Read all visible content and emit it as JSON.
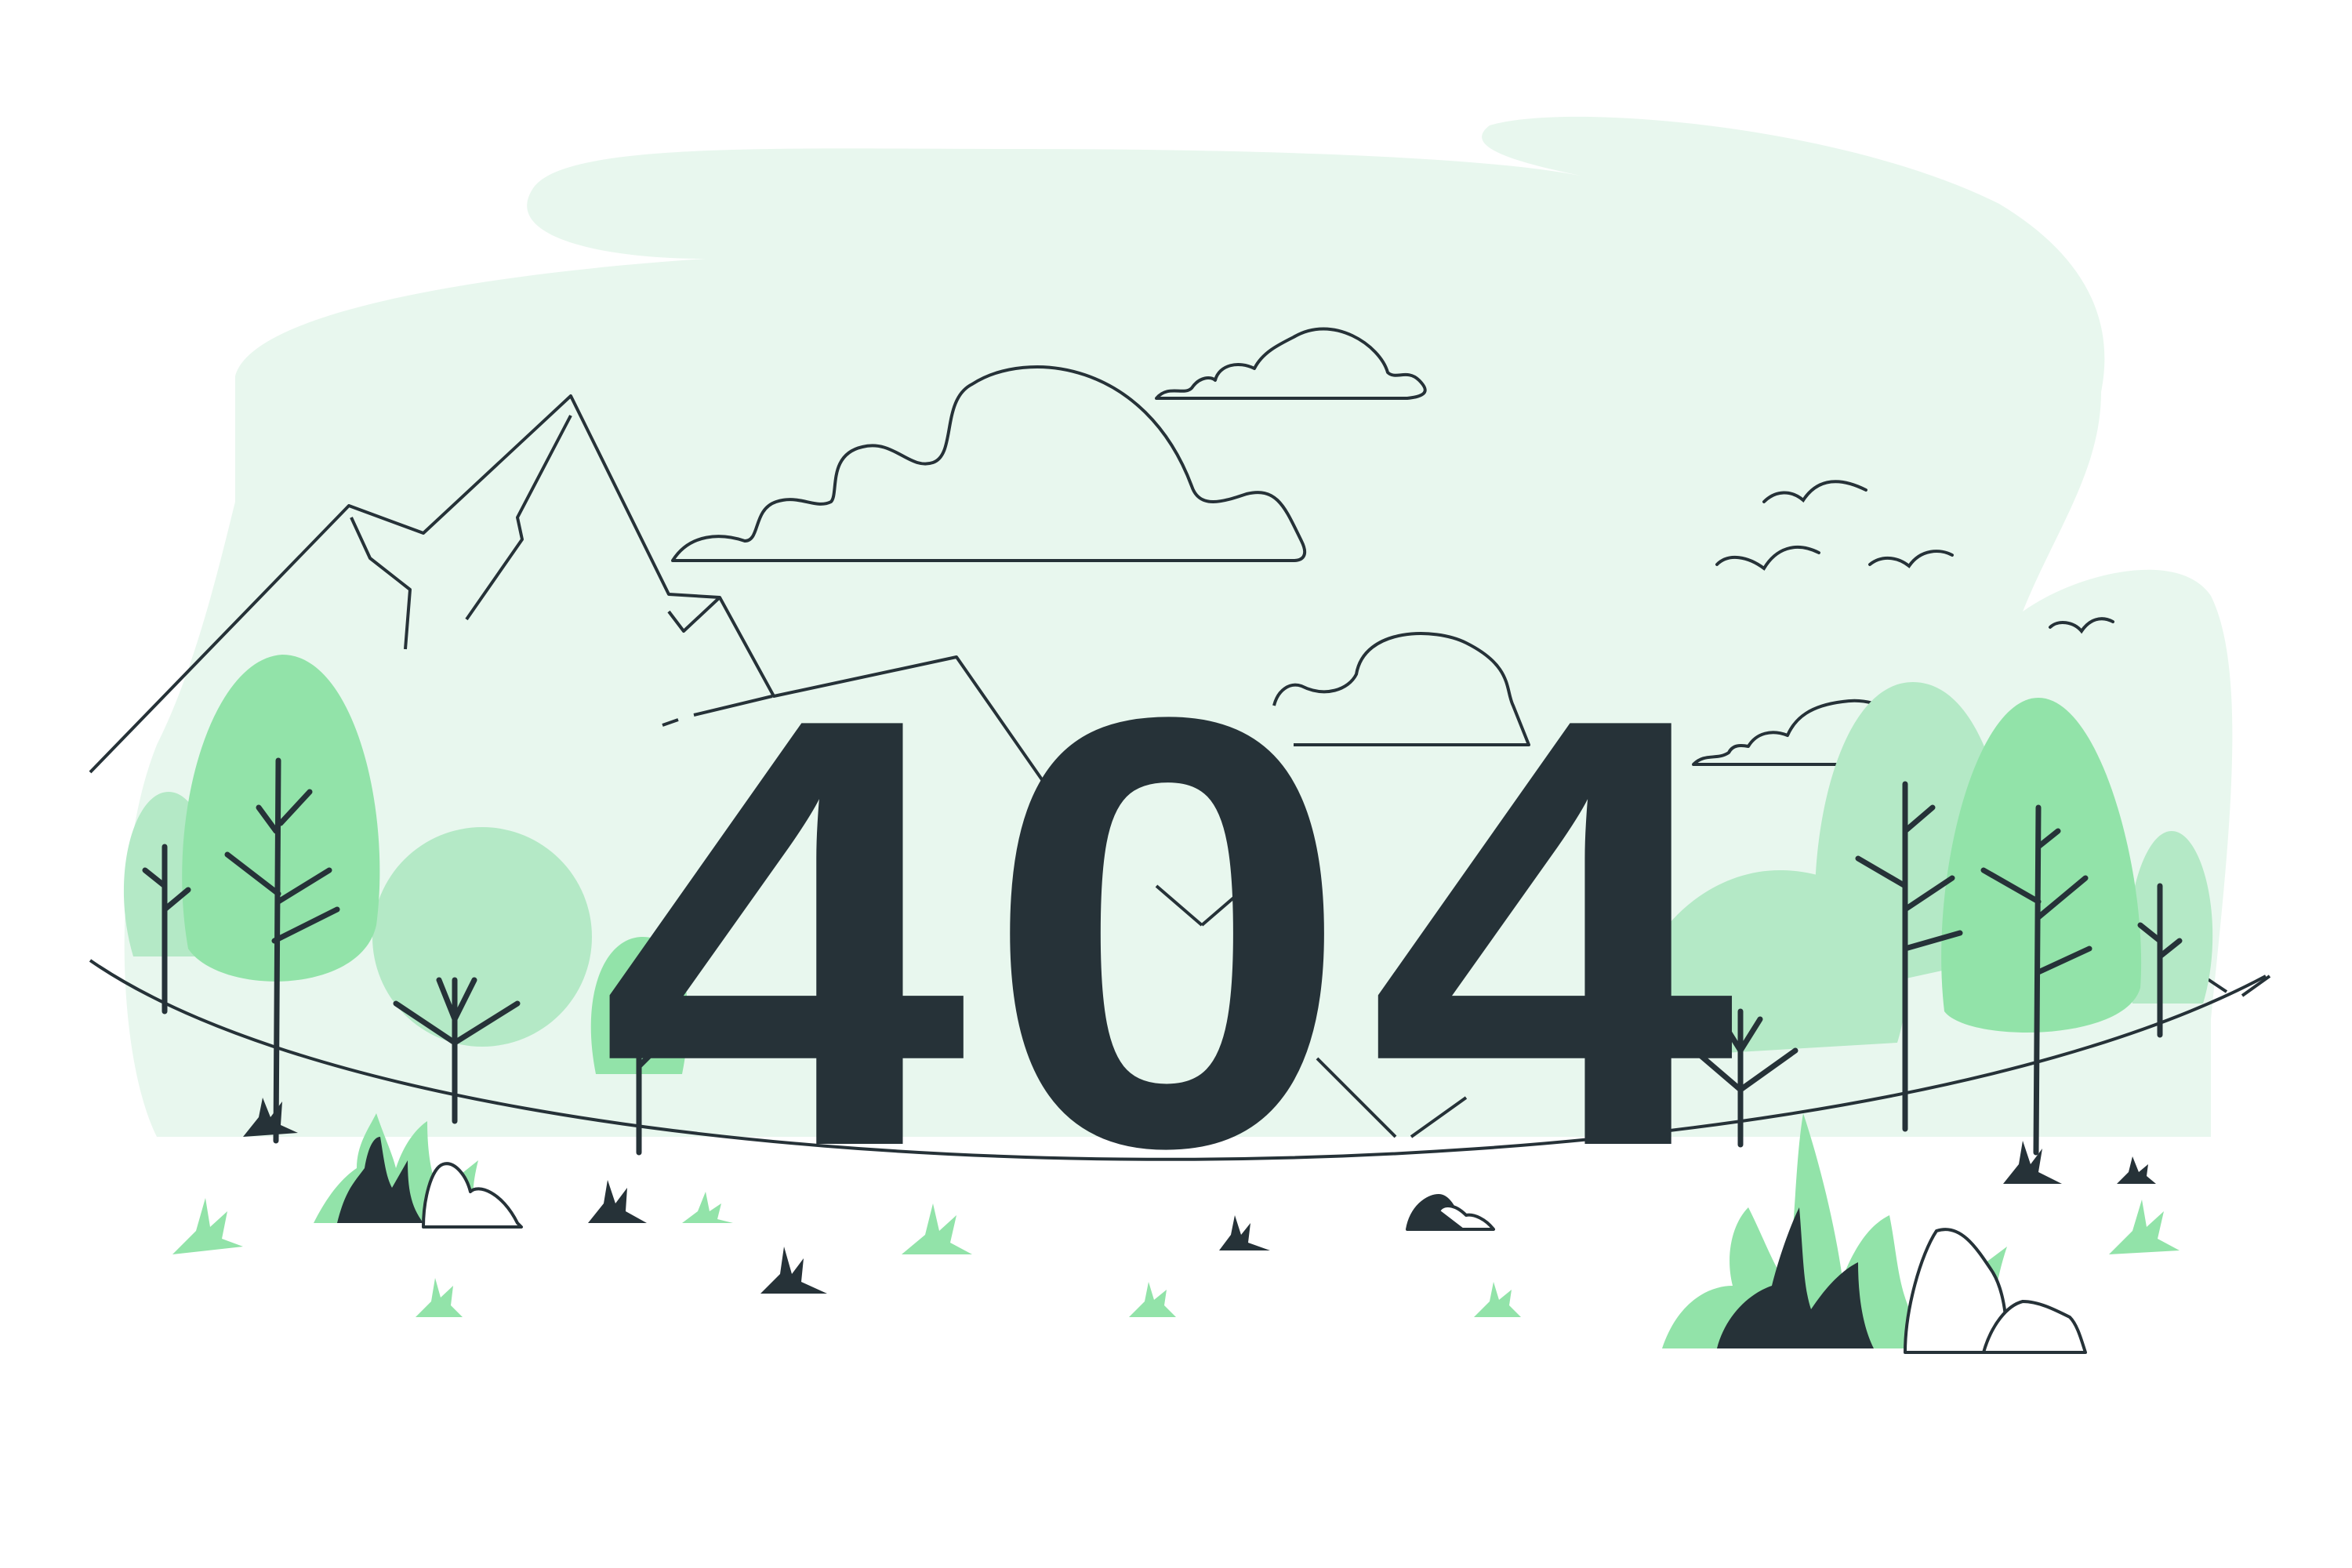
{
  "illustration": {
    "error_code": "404",
    "colors": {
      "background": "#ffffff",
      "sky": "#e8f7ee",
      "foliage_light": "#b4e9c6",
      "foliage_mid": "#92e3a9",
      "ink": "#263238"
    },
    "elements": [
      "mountains",
      "clouds",
      "birds",
      "trees",
      "bushes",
      "grass-tufts",
      "rocks"
    ]
  }
}
